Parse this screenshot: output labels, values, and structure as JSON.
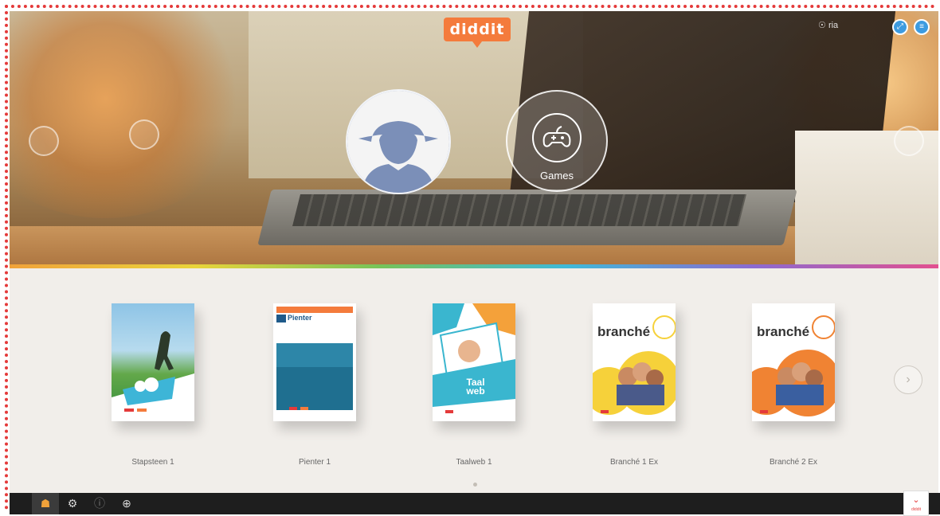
{
  "brand": {
    "logo": "diddit",
    "accent": "#f47b3c"
  },
  "header": {
    "user_label": "ria"
  },
  "hero": {
    "tiles": [
      {
        "icon": "user-silhouette-icon",
        "label": ""
      },
      {
        "icon": "gamepad-icon",
        "label": "Games"
      }
    ]
  },
  "books": [
    {
      "title": "Stapsteen 1",
      "cover_text": "",
      "color": "#58b233"
    },
    {
      "title": "Pienter 1",
      "cover_text": "Pienter",
      "color": "#2a8fb0"
    },
    {
      "title": "Taalweb 1",
      "cover_text": "Taal web",
      "color": "#3ab6cf"
    },
    {
      "title": "Branché 1 Ex",
      "cover_text": "branché",
      "color": "#f6d13a"
    },
    {
      "title": "Branché 2 Ex",
      "cover_text": "branché",
      "color": "#f08333"
    }
  ],
  "taskbar": {
    "items": [
      "home-icon",
      "settings-icon",
      "help-icon",
      "globe-icon"
    ]
  },
  "corner_button": {
    "label": "diddit"
  }
}
